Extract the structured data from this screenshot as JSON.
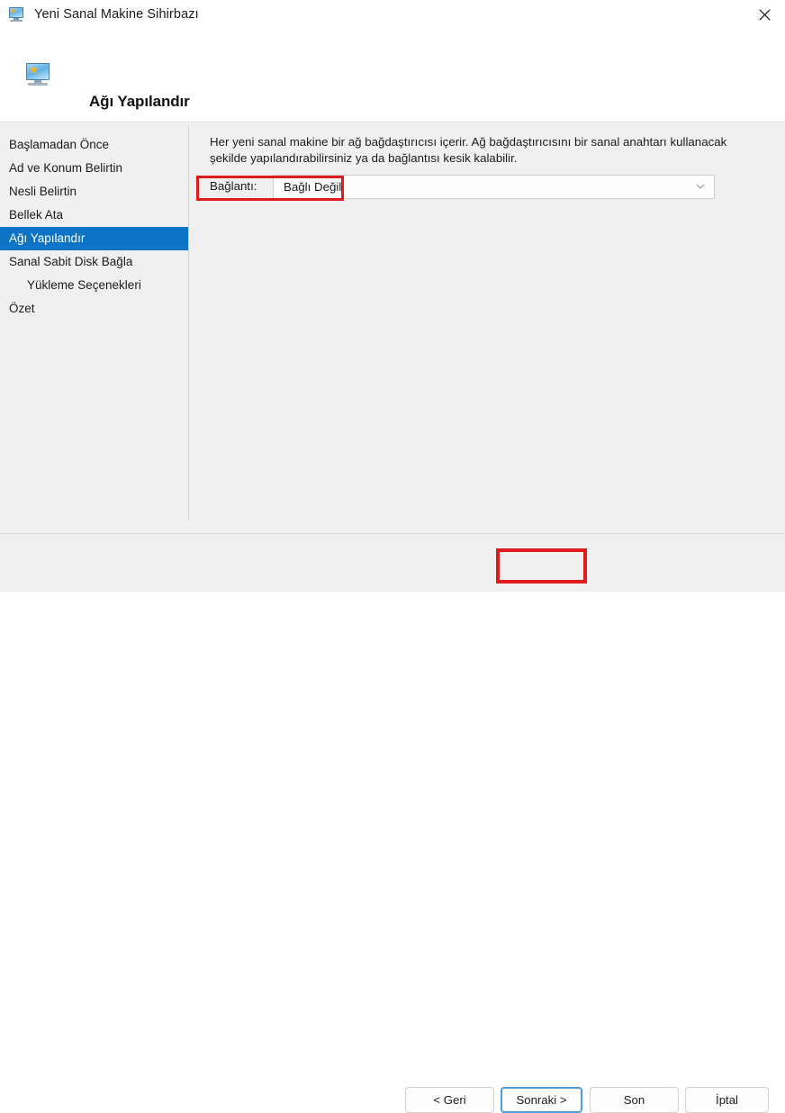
{
  "window": {
    "title": "Yeni Sanal Makine Sihirbazı",
    "icon": "virtual-machine-icon",
    "close_label": "✕"
  },
  "header": {
    "title": "Ağı Yapılandır",
    "icon": "virtual-machine-icon"
  },
  "sidebar": {
    "items": [
      {
        "label": "Başlamadan Önce",
        "selected": false,
        "indented": false
      },
      {
        "label": "Ad ve Konum Belirtin",
        "selected": false,
        "indented": false
      },
      {
        "label": "Nesli Belirtin",
        "selected": false,
        "indented": false
      },
      {
        "label": "Bellek Ata",
        "selected": false,
        "indented": false
      },
      {
        "label": "Ağı Yapılandır",
        "selected": true,
        "indented": false
      },
      {
        "label": "Sanal Sabit Disk Bağla",
        "selected": false,
        "indented": false
      },
      {
        "label": "Yükleme Seçenekleri",
        "selected": false,
        "indented": true
      },
      {
        "label": "Özet",
        "selected": false,
        "indented": false
      }
    ]
  },
  "main": {
    "description": "Her yeni sanal makine bir ağ bağdaştırıcısı içerir. Ağ bağdaştırıcısını bir sanal anahtarı kullanacak şekilde yapılandırabilirsiniz ya da bağlantısı kesik kalabilir.",
    "connection": {
      "label": "Bağlantı:",
      "value": "Bağlı Değil",
      "chevron_icon": "chevron-down-icon"
    }
  },
  "footer": {
    "buttons": [
      {
        "label": "< Geri",
        "name": "back-button"
      },
      {
        "label": "Sonraki >",
        "name": "next-button"
      },
      {
        "label": "Son",
        "name": "finish-button"
      },
      {
        "label": "İptal",
        "name": "cancel-button"
      }
    ]
  },
  "annotations": {
    "accent_color": "#e01b1b",
    "highlight_color": "#0b74c4",
    "focus_color": "#4a9ede",
    "targets": [
      "connection-field",
      "next-button"
    ]
  }
}
